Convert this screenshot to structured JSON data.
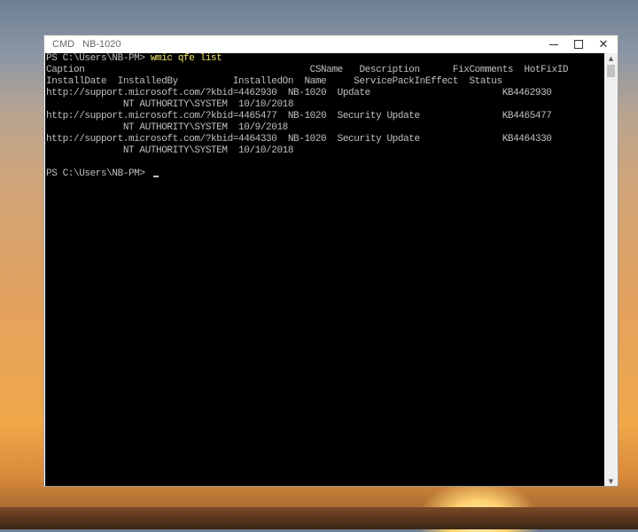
{
  "window": {
    "title": "CMD",
    "name": "NB-1020"
  },
  "console": {
    "lines": [
      {
        "prompt": "PS C:\\Users\\NB-PM> ",
        "command": "wmic qfe list"
      },
      {
        "text": "Caption                                         CSName   Description      FixComments  HotFixID"
      },
      {
        "text": "InstallDate  InstalledBy          InstalledOn  Name     ServicePackInEffect  Status"
      },
      {
        "text": "http://support.microsoft.com/?kbid=4462930  NB-1020  Update                        KB4462930"
      },
      {
        "text": "              NT AUTHORITY\\SYSTEM  10/10/2018"
      },
      {
        "text": "http://support.microsoft.com/?kbid=4465477  NB-1020  Security Update               KB4465477"
      },
      {
        "text": "              NT AUTHORITY\\SYSTEM  10/9/2018"
      },
      {
        "text": "http://support.microsoft.com/?kbid=4464330  NB-1020  Security Update               KB4464330"
      },
      {
        "text": "              NT AUTHORITY\\SYSTEM  10/10/2018"
      },
      {
        "text": ""
      },
      {
        "prompt": "PS C:\\Users\\NB-PM> ",
        "command": ""
      }
    ]
  },
  "colors": {
    "console_bg": "#000000",
    "console_text": "#c0c0c0",
    "command_text": "#f5e66a"
  },
  "icons": {
    "minimize": "minimize-icon",
    "maximize": "maximize-icon",
    "close": "close-icon",
    "scroll_up": "scroll-up-arrow-icon",
    "scroll_down": "scroll-down-arrow-icon"
  }
}
